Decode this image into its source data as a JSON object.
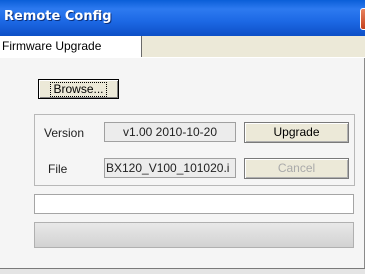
{
  "window": {
    "title": "Remote Config"
  },
  "tabs": [
    {
      "label": "Firmware Upgrade",
      "active": true
    }
  ],
  "firmware": {
    "browse_label": "Browse...",
    "version_label": "Version",
    "version_value": "v1.00 2010-10-20",
    "upgrade_label": "Upgrade",
    "file_label": "File",
    "file_value": "BX120_V100_101020.i",
    "cancel_label": "Cancel",
    "cancel_enabled": false,
    "path_value": "",
    "progress_percent": 0
  },
  "colors": {
    "titlebar": "#1c68e4",
    "title_text": "#ffffff",
    "panel": "#f5f5f5",
    "disabled_text": "#aaaaaa"
  }
}
